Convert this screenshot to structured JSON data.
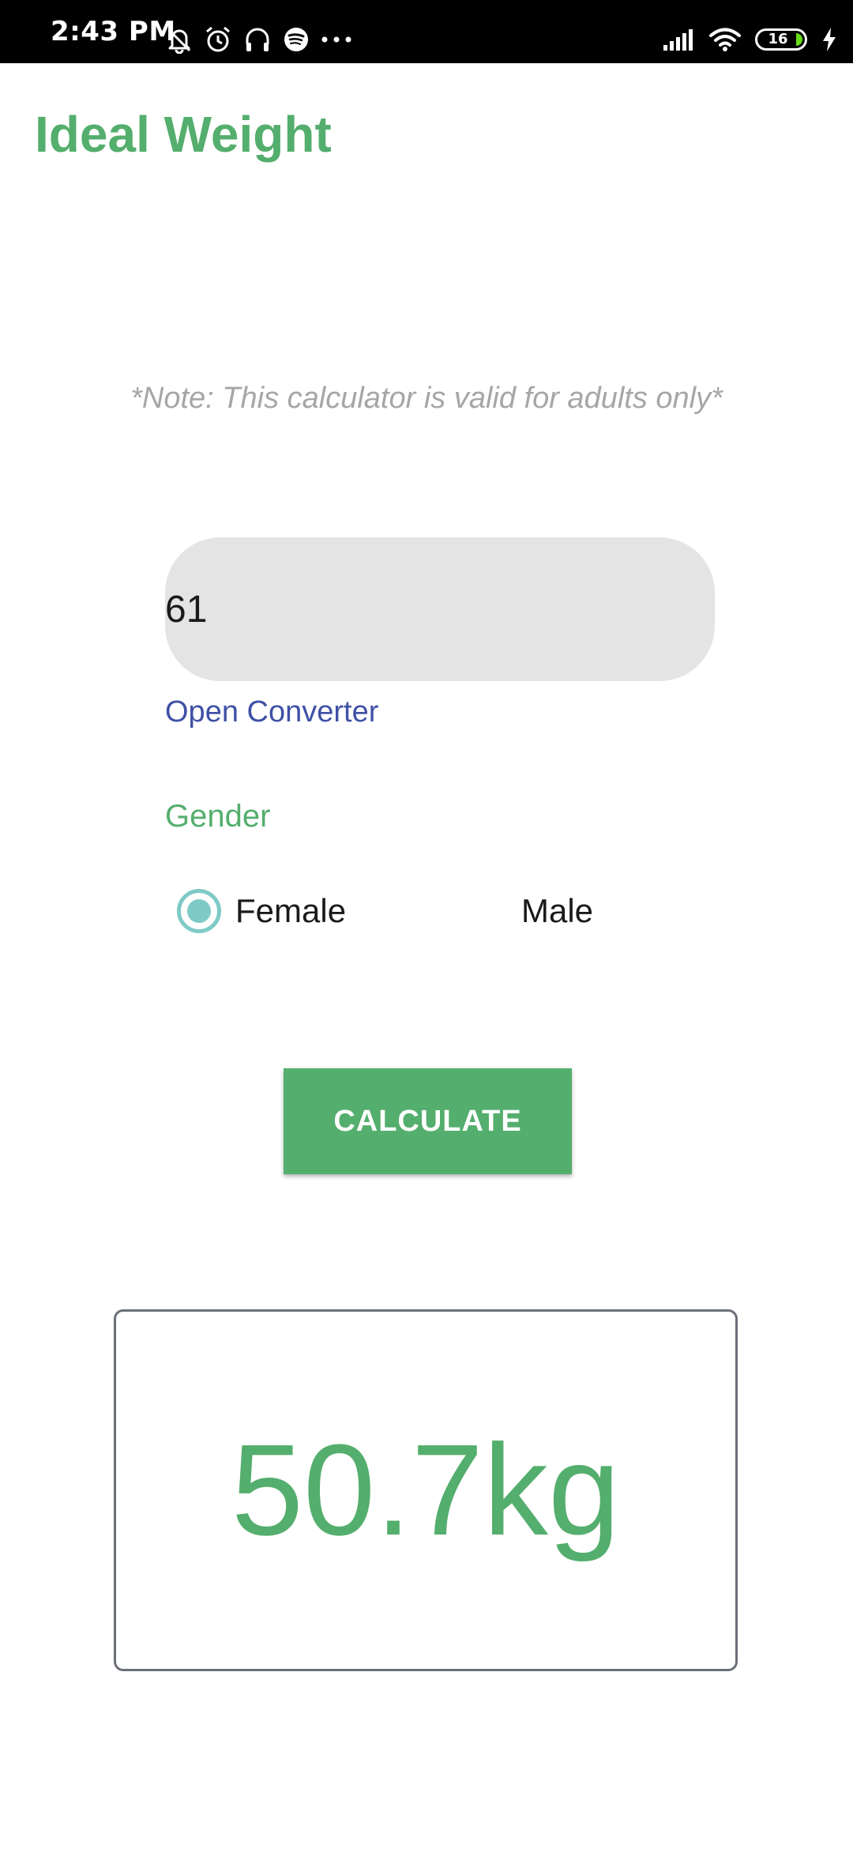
{
  "status_bar": {
    "time": "2:43 PM",
    "battery_level": "16",
    "left_icons": [
      "bell-off-icon",
      "alarm-icon",
      "headphones-icon",
      "spotify-icon",
      "more-icon"
    ],
    "right_icons": [
      "signal-icon",
      "wifi-icon",
      "battery-icon",
      "charging-icon"
    ]
  },
  "app": {
    "title": "Ideal Weight"
  },
  "note": "*Note: This calculator is valid for adults only*",
  "weight_input": {
    "value": "61"
  },
  "converter_link": "Open Converter",
  "gender": {
    "label": "Gender",
    "options": [
      {
        "label": "Female",
        "selected": true
      },
      {
        "label": "Male",
        "selected": false
      }
    ]
  },
  "calculate_button": "CALCULATE",
  "result": {
    "value": "50.7kg"
  },
  "colors": {
    "accent_green": "#54ae6d",
    "link_blue": "#3f51a5",
    "radio_teal": "#7fcac6",
    "input_bg": "#e4e4e4",
    "note_gray": "#a6a6a6"
  }
}
